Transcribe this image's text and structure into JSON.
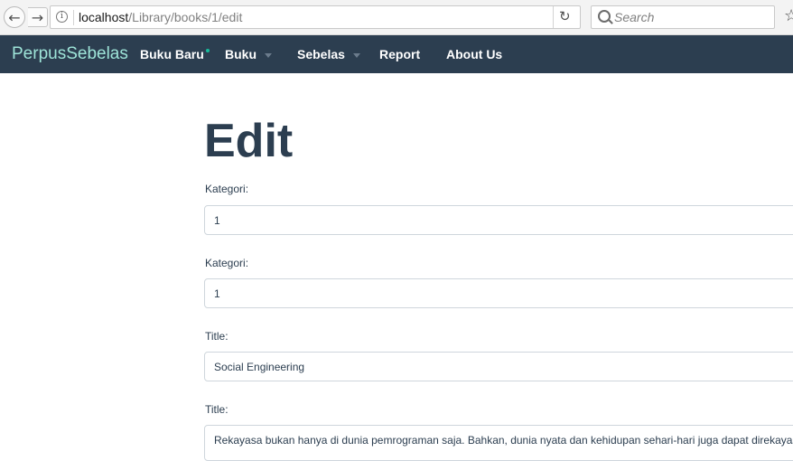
{
  "browser": {
    "url_host": "localhost",
    "url_path": "/Library/books/1/edit",
    "search_placeholder": "Search",
    "back_glyph": "←",
    "forward_glyph": "→",
    "reload_glyph": "↻",
    "bookmark_glyph": "☆",
    "info_glyph": "i"
  },
  "navbar": {
    "brand": "PerpusSebelas",
    "items": [
      {
        "label": "Buku Baru",
        "has_dot": true
      },
      {
        "label": "Buku",
        "has_caret": true
      },
      {
        "label": "Sebelas",
        "has_caret": true
      },
      {
        "label": "Report"
      },
      {
        "label": "About Us"
      }
    ],
    "colors": {
      "background": "#2c3e50",
      "brand": "#9ee4d8",
      "dot": "#18bc9c"
    }
  },
  "form": {
    "title": "Edit",
    "fields": [
      {
        "label": "Kategori:",
        "value": "1"
      },
      {
        "label": "Kategori:",
        "value": "1"
      },
      {
        "label": "Title:",
        "value": "Social Engineering"
      },
      {
        "label": "Title:",
        "value": "Rekayasa bukan hanya di dunia pemrograman saja. Bahkan, dunia nyata dan kehidupan sehari-hari juga dapat direkayasa. Te"
      }
    ]
  },
  "icons": [
    "back-arrow-icon",
    "forward-arrow-icon",
    "info-icon",
    "reload-icon",
    "search-icon",
    "bookmark-star-icon",
    "caret-down-icon"
  ]
}
